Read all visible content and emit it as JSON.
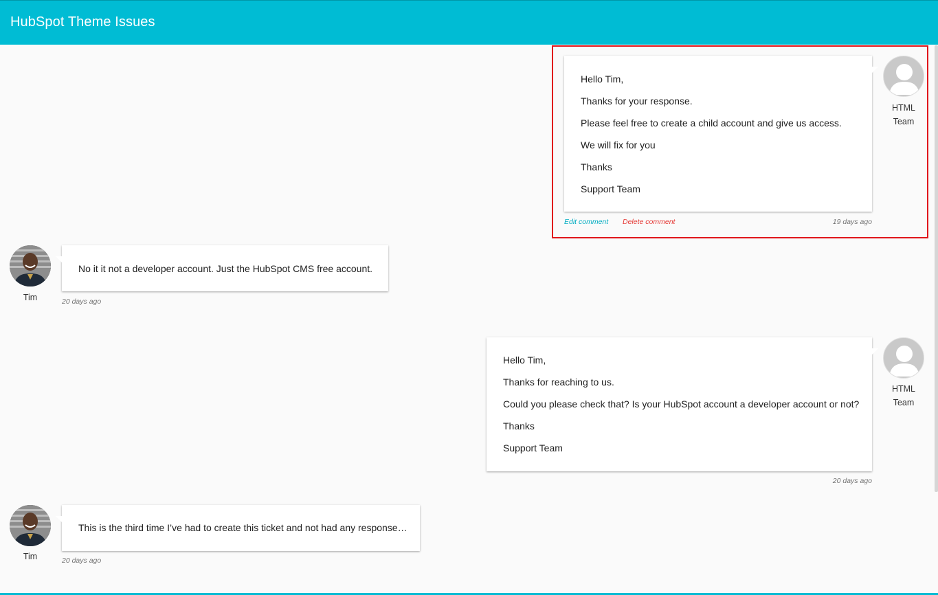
{
  "header": {
    "title": "HubSpot Theme Issues"
  },
  "colors": {
    "header_bg": "#00bcd4",
    "edit_link": "#00acc1",
    "delete_link": "#e53935",
    "highlight_border": "#e0161b"
  },
  "comments": [
    {
      "author": "HTML Team",
      "author_line1": "HTML",
      "author_line2": "Team",
      "avatar": "default-user-icon",
      "lines": [
        "Hello Tim,",
        "Thanks for your response.",
        "Please feel free to create a child account and give us access.",
        "We will fix for you",
        "Thanks",
        "Support Team"
      ],
      "edit_label": "Edit comment",
      "delete_label": "Delete comment",
      "time": "19 days ago"
    },
    {
      "author": "Tim",
      "avatar": "tim-photo",
      "lines": [
        "No it it not a developer account. Just the HubSpot CMS free account."
      ],
      "time": "20 days ago"
    },
    {
      "author": "HTML Team",
      "author_line1": "HTML",
      "author_line2": "Team",
      "avatar": "default-user-icon",
      "lines": [
        "Hello Tim,",
        "Thanks for reaching to us.",
        "Could you please check that? Is your HubSpot account a developer account or not?",
        "Thanks",
        "Support Team"
      ],
      "time": "20 days ago"
    },
    {
      "author": "Tim",
      "avatar": "tim-photo",
      "lines": [
        "This is the third time I’ve had to create this ticket and not had any response…"
      ],
      "time": "20 days ago"
    }
  ]
}
